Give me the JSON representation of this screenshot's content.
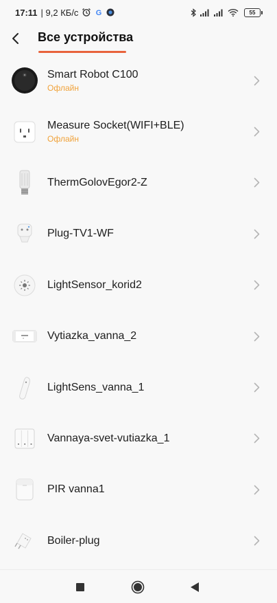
{
  "status_bar": {
    "time": "17:11",
    "net_speed": "| 9,2 КБ/с",
    "battery": "55"
  },
  "header": {
    "title": "Все устройства",
    "accent_color": "#e8633c"
  },
  "devices": [
    {
      "name": "Smart Robot C100",
      "status": "Офлайн",
      "icon": "robot-vacuum-icon"
    },
    {
      "name": "Measure Socket(WIFI+BLE)",
      "status": "Офлайн",
      "icon": "wall-socket-icon"
    },
    {
      "name": "ThermGolovEgor2-Z",
      "status": "",
      "icon": "thermostat-head-icon"
    },
    {
      "name": "Plug-TV1-WF",
      "status": "",
      "icon": "smart-plug-icon"
    },
    {
      "name": "LightSensor_korid2",
      "status": "",
      "icon": "light-sensor-icon"
    },
    {
      "name": "Vytiazka_vanna_2",
      "status": "",
      "icon": "switch-module-icon"
    },
    {
      "name": "LightSens_vanna_1",
      "status": "",
      "icon": "light-sensor-slim-icon"
    },
    {
      "name": "Vannaya-svet-vutiazka_1",
      "status": "",
      "icon": "triple-switch-icon"
    },
    {
      "name": "PIR vanna1",
      "status": "",
      "icon": "motion-sensor-icon"
    },
    {
      "name": "Boiler-plug",
      "status": "",
      "icon": "plug-adapter-icon"
    }
  ],
  "colors": {
    "offline_status": "#f0a23a",
    "background": "#f8f8f8"
  }
}
